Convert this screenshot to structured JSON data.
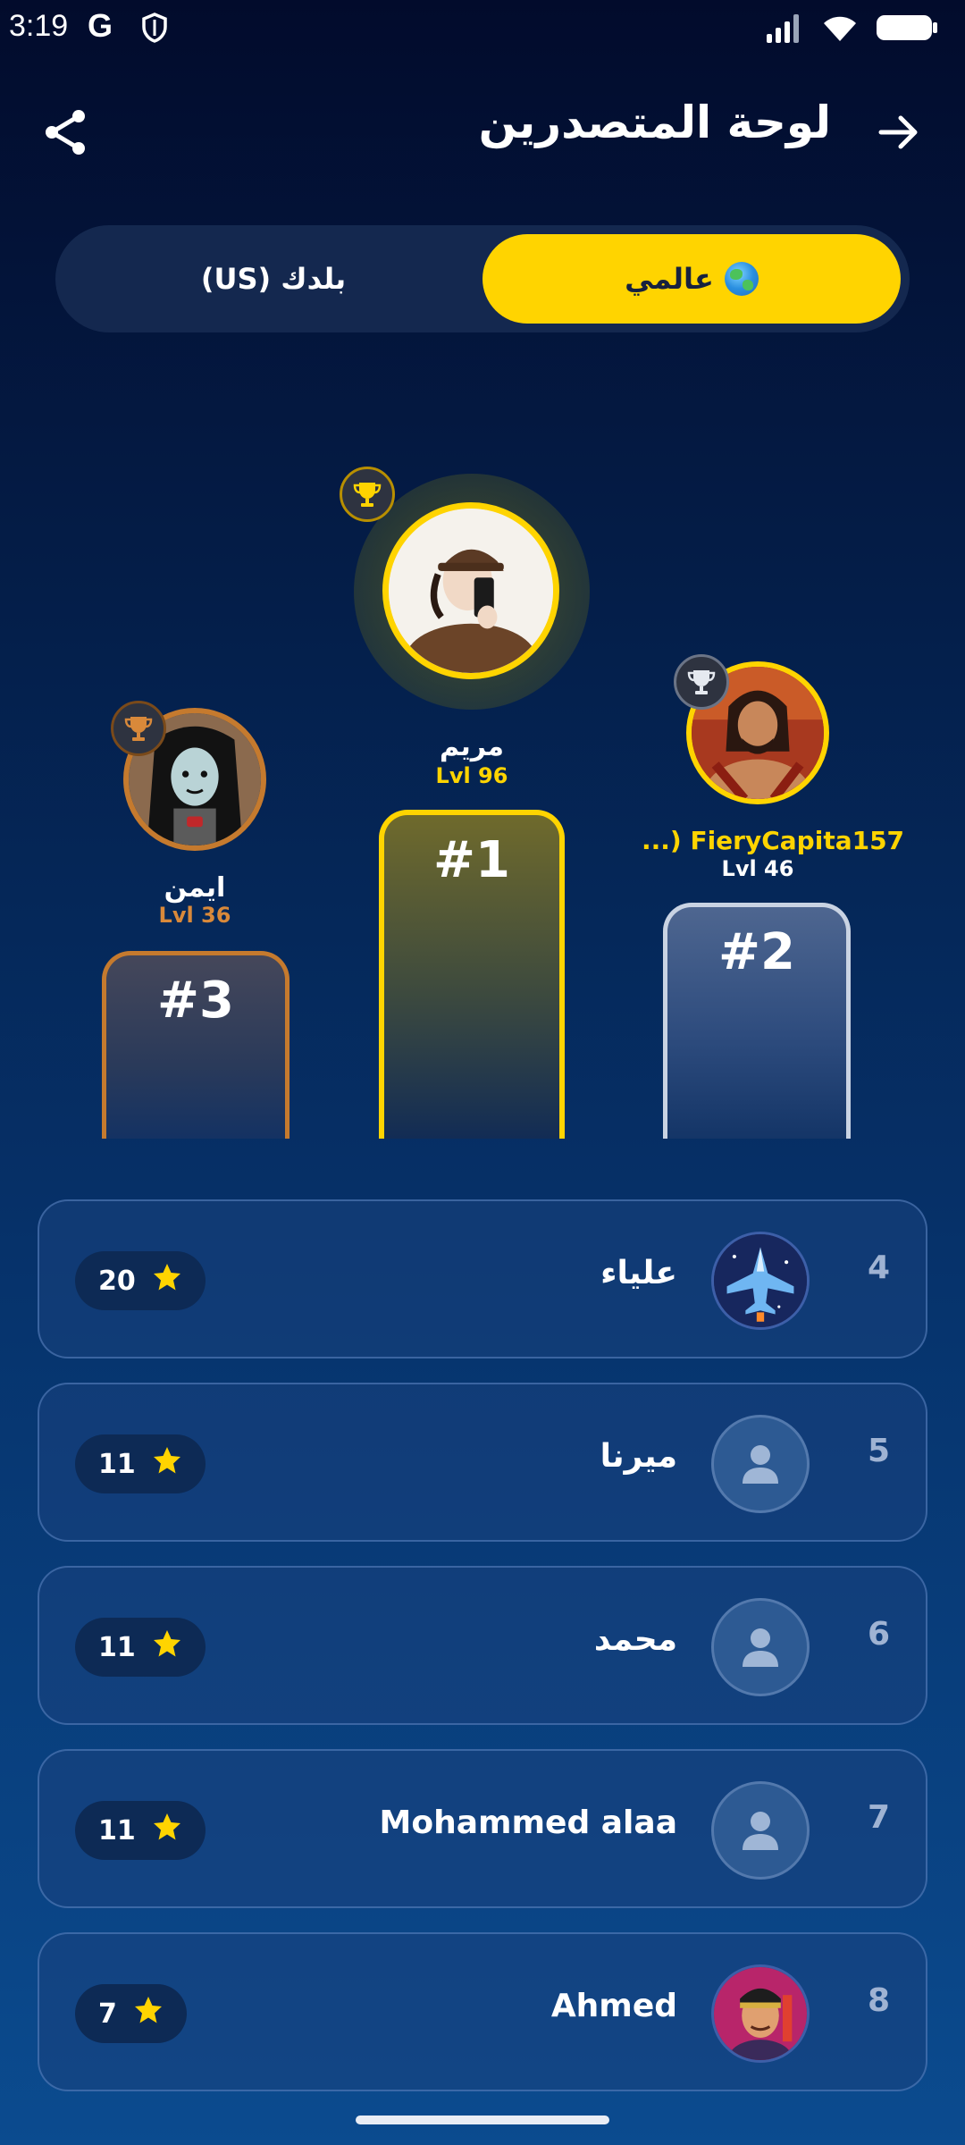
{
  "status_bar": {
    "time": "3:19",
    "g_label": "G"
  },
  "header": {
    "title": "لوحة المتصدرين"
  },
  "tabs": {
    "global_label": "عالمي",
    "country_label": "بلدك (US)",
    "active": "global"
  },
  "podium": {
    "first": {
      "name": "مريم",
      "level": "Lvl 96",
      "rank_label": "#1"
    },
    "second": {
      "name": "...) FieryCapita157",
      "level": "Lvl 46",
      "rank_label": "#2"
    },
    "third": {
      "name": "ايمن",
      "level": "Lvl 36",
      "rank_label": "#3"
    }
  },
  "list": [
    {
      "rank": "4",
      "name": "علياء",
      "score": "20",
      "avatar": "jet-avatar"
    },
    {
      "rank": "5",
      "name": "ميرنا",
      "score": "11",
      "avatar": "person-placeholder"
    },
    {
      "rank": "6",
      "name": "محمد",
      "score": "11",
      "avatar": "person-placeholder"
    },
    {
      "rank": "7",
      "name": "Mohammed alaa",
      "score": "11",
      "avatar": "person-placeholder"
    },
    {
      "rank": "8",
      "name": "Ahmed",
      "score": "7",
      "avatar": "character-avatar"
    }
  ],
  "colors": {
    "accent": "#ffd400",
    "gold": "#ffd400",
    "silver": "#c9d3e3",
    "bronze": "#c57a2e"
  }
}
